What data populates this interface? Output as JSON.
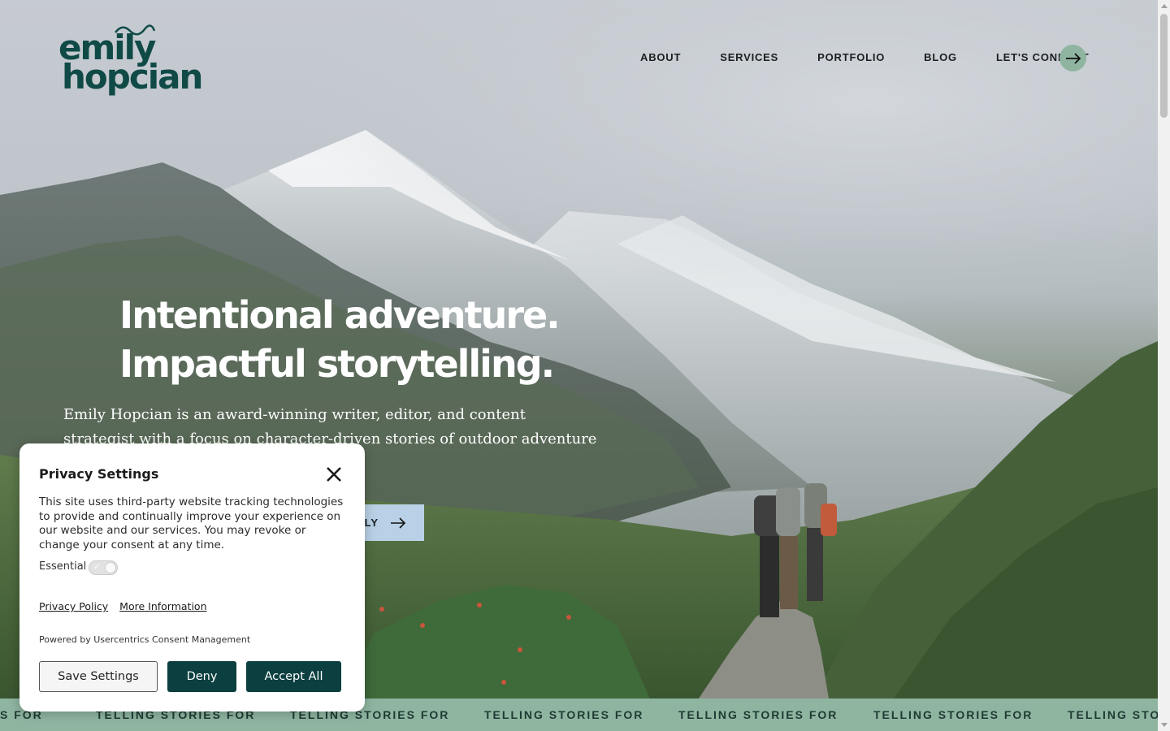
{
  "brand": {
    "logo_line1": "emily",
    "logo_line2": "hopcian",
    "logo_color": "#0f4a47"
  },
  "nav": {
    "items": [
      {
        "label": "ABOUT"
      },
      {
        "label": "SERVICES"
      },
      {
        "label": "PORTFOLIO"
      },
      {
        "label": "BLOG"
      }
    ],
    "connect_label": "LET'S CONNECT",
    "connect_icon": "arrow-right-icon",
    "accent": "#8fb5a1"
  },
  "hero": {
    "headline_line1": "Intentional adventure.",
    "headline_line2": "Impactful storytelling.",
    "intro": "Emily Hopcian is an award-winning writer, editor, and content strategist with a focus on character-driven stories of outdoor adventure and social impact.",
    "cta_visible_text": "LY",
    "cta_icon": "arrow-right-icon",
    "cta_color": "#b9d1e6"
  },
  "ticker": {
    "items": [
      "S FOR",
      "TELLING STORIES FOR",
      "TELLING STORIES FOR",
      "TELLING STORIES FOR",
      "TELLING STORIES FOR",
      "TELLING STORIES FOR",
      "TELLING STORIE"
    ],
    "background": "#8fb5a1"
  },
  "privacy": {
    "title": "Privacy Settings",
    "close_icon": "close-icon",
    "description": "This site uses third-party website tracking technologies to provide and continually improve your experience on our website and our services. You may revoke or change your consent at any time.",
    "essential_label": "Essential",
    "essential_enabled": true,
    "privacy_policy_link": "Privacy Policy",
    "more_info_link": "More Information",
    "powered_by": "Powered by Usercentrics Consent Management",
    "buttons": {
      "save": "Save Settings",
      "deny": "Deny",
      "accept": "Accept All"
    },
    "button_color": "#0c3f3f"
  }
}
